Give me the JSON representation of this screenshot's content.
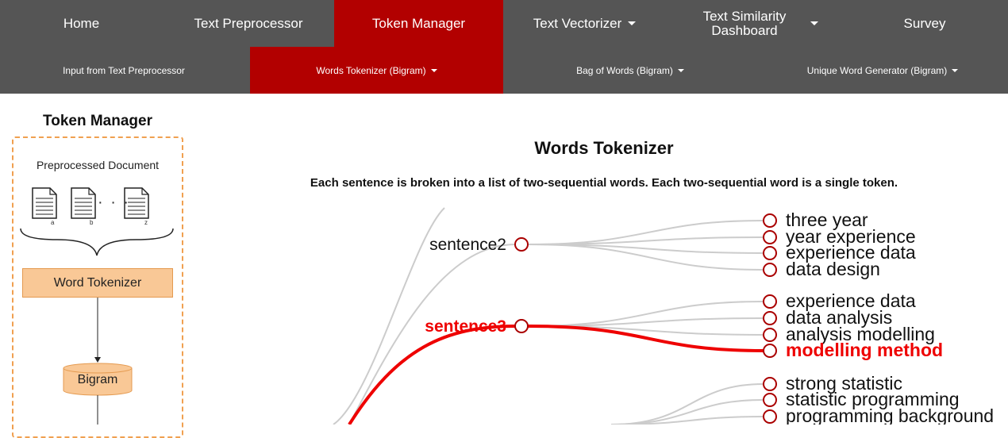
{
  "nav": {
    "primary": [
      {
        "label": "Home",
        "dropdown": false
      },
      {
        "label": "Text Preprocessor",
        "dropdown": false
      },
      {
        "label": "Token Manager",
        "dropdown": false,
        "active": true
      },
      {
        "label": "Text Vectorizer",
        "dropdown": true
      },
      {
        "label": "Text Similarity Dashboard",
        "dropdown": true
      },
      {
        "label": "Survey",
        "dropdown": false
      }
    ],
    "secondary": [
      {
        "label": "Input from Text Preprocessor",
        "dropdown": false
      },
      {
        "label": "Words Tokenizer (Bigram)",
        "dropdown": true,
        "active": true
      },
      {
        "label": "Bag of Words (Bigram)",
        "dropdown": true
      },
      {
        "label": "Unique Word Generator (Bigram)",
        "dropdown": true
      }
    ]
  },
  "diagram": {
    "title": "Token Manager",
    "preprocessed_label": "Preprocessed Document",
    "doc_labels": [
      "a",
      "b",
      "z"
    ],
    "dots": "· · ·",
    "word_tokenizer_label": "Word Tokenizer",
    "bigram_label": "Bigram"
  },
  "main": {
    "title": "Words Tokenizer",
    "description": "Each sentence is broken into a list of two-sequential words. Each two-sequential word is a single token."
  },
  "tree": {
    "sentences": [
      {
        "label": "sentence2",
        "highlighted": false,
        "tokens": [
          {
            "label": "three year",
            "highlighted": false
          },
          {
            "label": "year experience",
            "highlighted": false
          },
          {
            "label": "experience data",
            "highlighted": false
          },
          {
            "label": "data design",
            "highlighted": false
          }
        ]
      },
      {
        "label": "sentence3",
        "highlighted": true,
        "tokens": [
          {
            "label": "experience data",
            "highlighted": false
          },
          {
            "label": "data analysis",
            "highlighted": false
          },
          {
            "label": "analysis modelling",
            "highlighted": false
          },
          {
            "label": "modelling method",
            "highlighted": true
          }
        ]
      },
      {
        "label": "",
        "highlighted": false,
        "tokens": [
          {
            "label": "strong statistic",
            "highlighted": false
          },
          {
            "label": "statistic programming",
            "highlighted": false
          },
          {
            "label": "programming background",
            "highlighted": false
          }
        ]
      }
    ]
  },
  "colors": {
    "nav_bg": "#555555",
    "active_bg": "#b20000",
    "highlight": "#ee0000",
    "node_stroke": "#aa0000",
    "link_gray": "#cccccc",
    "diagram_orange": "#f9c896"
  }
}
